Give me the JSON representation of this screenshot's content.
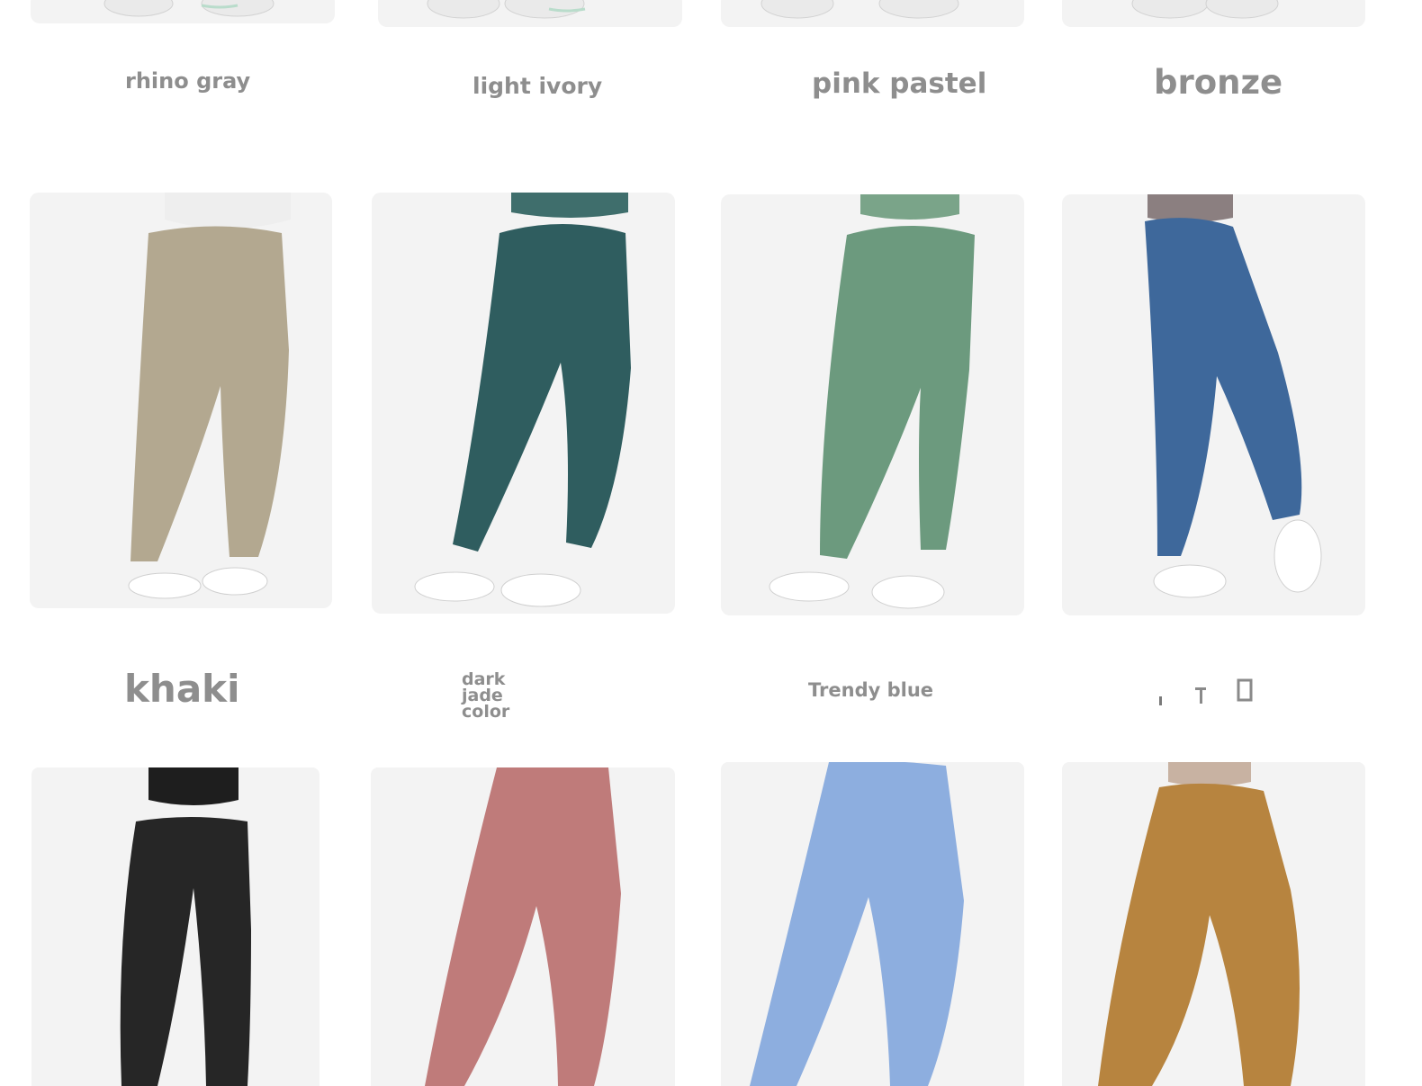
{
  "gallery": {
    "rows": [
      {
        "items": [
          {
            "label": "rhino gray",
            "color": "#ffffff"
          },
          {
            "label": "light ivory",
            "color": "#ffffff"
          },
          {
            "label": "pink pastel",
            "color": "#ffffff"
          },
          {
            "label": "bronze",
            "color": "#ffffff"
          }
        ]
      },
      {
        "items": [
          {
            "label": "khaki",
            "color": "#b3a890",
            "top": "#eeeeee"
          },
          {
            "label": "dark jade color",
            "color": "#2f5d5f",
            "top": "#3f6e6c"
          },
          {
            "label": "Trendy blue",
            "color": "#6c9a7e",
            "top": "#7aa489"
          },
          {
            "label": "",
            "color": "#3e689b",
            "top": "#8b7f80"
          }
        ]
      },
      {
        "items": [
          {
            "color": "#262626",
            "top": "#1e1e1e"
          },
          {
            "color": "#bf7b7a",
            "top": "#b56e6c"
          },
          {
            "color": "#8daedf",
            "top": "#a9c3e8"
          },
          {
            "color": "#b7843f",
            "top": "#c8b2a2"
          }
        ]
      }
    ]
  }
}
